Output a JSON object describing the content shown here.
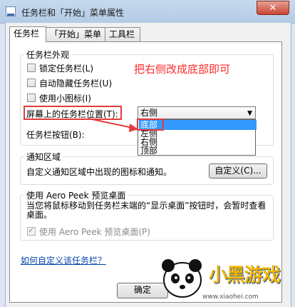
{
  "window": {
    "title": "任务栏和「开始」菜单属性",
    "close_glyph": "✕"
  },
  "tabs": [
    {
      "label": "任务栏",
      "active": true
    },
    {
      "label": "「开始」菜单",
      "active": false
    },
    {
      "label": "工具栏",
      "active": false
    }
  ],
  "appearance": {
    "legend": "任务栏外观",
    "checkboxes": [
      {
        "label": "锁定任务栏(L)",
        "checked": false
      },
      {
        "label": "自动隐藏任务栏(U)",
        "checked": false
      },
      {
        "label": "使用小图标(I)",
        "checked": false
      }
    ],
    "position_label": "屏幕上的任务栏位置(T):",
    "position_value": "右侧",
    "buttons_label": "任务栏按钮(B):",
    "dropdown_options": [
      "底部",
      "左侧",
      "右侧",
      "顶部"
    ],
    "dropdown_selected": "底部"
  },
  "annotation": {
    "note": "把右侧改成底部即可",
    "color": "#e23b3b"
  },
  "notification": {
    "legend": "通知区域",
    "description": "自定义通知区域中出现的图标和通知。",
    "customize_button": "自定义(C)..."
  },
  "aero": {
    "legend": "使用 Aero Peek 预览桌面",
    "description": "当您将鼠标移动到任务栏末端的“显示桌面”按钮时，会暂时查看桌面。",
    "checkbox_label": "使用 Aero Peek 预览桌面(P)",
    "checkbox_checked": true
  },
  "help_link": "如何自定义该任务栏？",
  "footer": {
    "ok_button": "确定"
  },
  "watermark": {
    "brand": "小黑游戏",
    "url": "www.xiaohei.com"
  }
}
